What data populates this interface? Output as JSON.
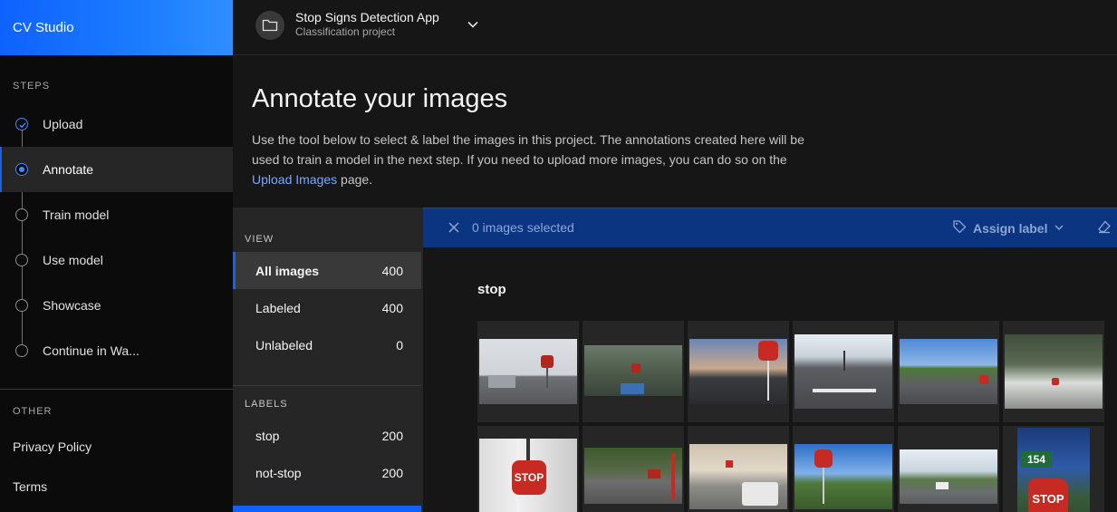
{
  "app": {
    "brand": "CV Studio"
  },
  "sidebar": {
    "steps_title": "STEPS",
    "steps": [
      {
        "label": "Upload",
        "state": "done"
      },
      {
        "label": "Annotate",
        "state": "active"
      },
      {
        "label": "Train model",
        "state": "todo"
      },
      {
        "label": "Use model",
        "state": "todo"
      },
      {
        "label": "Showcase",
        "state": "todo"
      },
      {
        "label": "Continue in Wa...",
        "state": "todo"
      }
    ],
    "other_title": "OTHER",
    "links": [
      "Privacy Policy",
      "Terms"
    ]
  },
  "header": {
    "project_name": "Stop Signs Detection App",
    "project_type": "Classification project",
    "icon": "folder-icon"
  },
  "main": {
    "title": "Annotate your images",
    "desc_before": "Use the tool below to select & label the images in this project. The annotations created here will be used to train a model in the next step. If you need to upload more images, you can do so on the ",
    "desc_link": "Upload Images",
    "desc_after": " page."
  },
  "view_panel": {
    "view_title": "VIEW",
    "views": [
      {
        "label": "All images",
        "count": "400"
      },
      {
        "label": "Labeled",
        "count": "400"
      },
      {
        "label": "Unlabeled",
        "count": "0"
      }
    ],
    "labels_title": "LABELS",
    "labels": [
      {
        "label": "stop",
        "count": "200"
      },
      {
        "label": "not-stop",
        "count": "200"
      }
    ]
  },
  "selection_bar": {
    "text": "0 images selected",
    "assign_label": "Assign label"
  },
  "gallery": {
    "group_label": "stop",
    "thumb_count": 12
  },
  "colors": {
    "brand": "#0f62fe",
    "selection_bar": "#0b3580",
    "link": "#78a9ff"
  }
}
